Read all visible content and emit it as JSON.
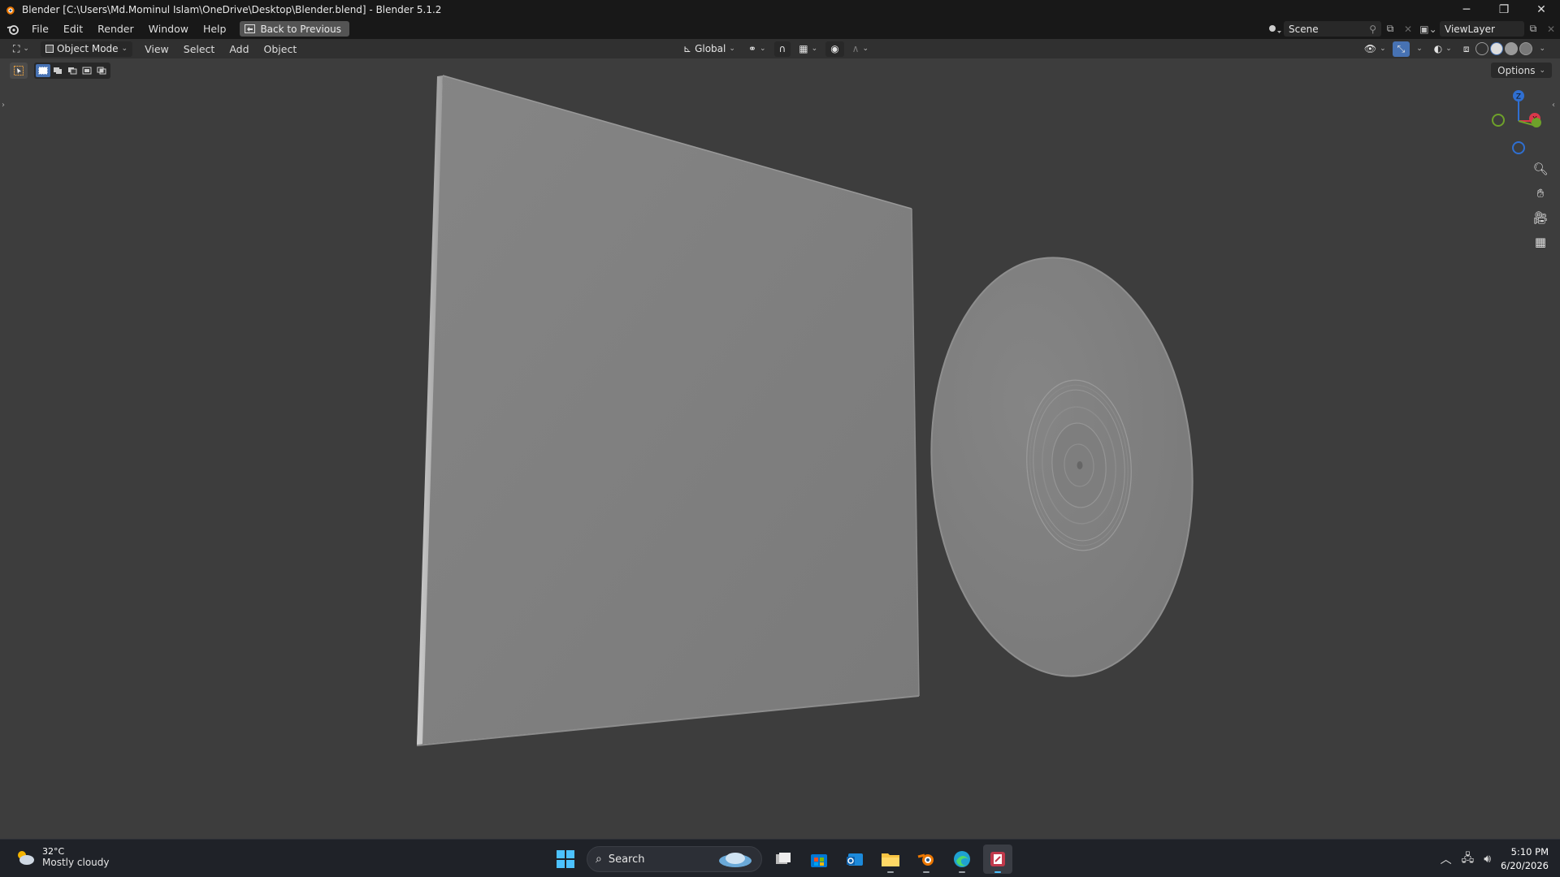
{
  "window": {
    "title": "Blender [C:\\Users\\Md.Mominul Islam\\OneDrive\\Desktop\\Blender.blend] - Blender 5.1.2",
    "controls": [
      "minimize",
      "restore",
      "close"
    ]
  },
  "menu": {
    "items": [
      "File",
      "Edit",
      "Render",
      "Window",
      "Help"
    ],
    "back_button": "Back to Previous",
    "scene": "Scene",
    "view_layer": "ViewLayer"
  },
  "viewport_header": {
    "mode": "Object Mode",
    "menus": [
      "View",
      "Select",
      "Add",
      "Object"
    ],
    "transform_orientation": "Global",
    "options": "Options",
    "shading_active": "solid"
  },
  "gizmo": {
    "axes": [
      "Z",
      "X"
    ]
  },
  "taskbar": {
    "weather_temp": "32°C",
    "weather_cond": "Mostly cloudy",
    "search_placeholder": "Search",
    "time": "5:10 PM",
    "date": "6/20/2026"
  }
}
